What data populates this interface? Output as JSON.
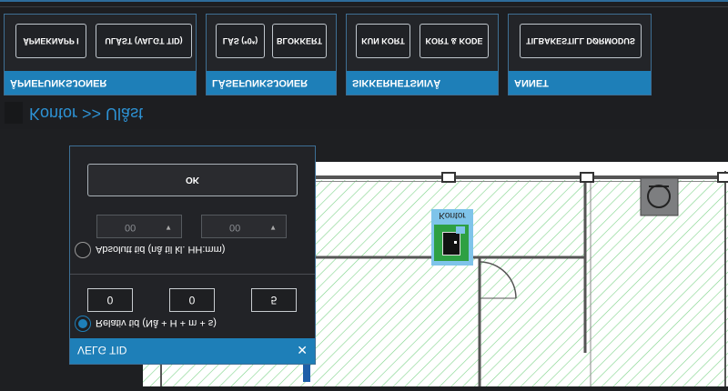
{
  "toolbar": {
    "groups": [
      {
        "caption": "ÅPNEFUNKSJONER",
        "buttons": [
          "ÅPNEKNAPP I",
          "ULÅST (VALGT TID)"
        ]
      },
      {
        "caption": "LÅSEFUNKSJONER",
        "buttons": [
          "LÅS (*0*)",
          "BLOKKERT"
        ]
      },
      {
        "caption": "SIKKERHETSNIVÅ",
        "buttons": [
          "KUN KORT",
          "KORT & KODE"
        ]
      },
      {
        "caption": "ANNET",
        "buttons": [
          "TILBAKESTILL DØRMODUS"
        ]
      }
    ]
  },
  "breadcrumb": "Kontor >> Ulåst",
  "floorplan": {
    "room_label": "Kontor"
  },
  "modal": {
    "title": "VELG TID",
    "ok_label": "OK",
    "absolute_label": "Absolutt tid (nå til kl. HH:mm)",
    "absolute_hours": "00",
    "absolute_minutes": "00",
    "relative_label": "Relativ tid (Nå + H + m + s)",
    "relative_h": "0",
    "relative_m": "0",
    "relative_s": "5",
    "close_symbol": "✕"
  },
  "colors": {
    "accent": "#1e7fb8",
    "room_green": "#2ea043",
    "hatch": "#6fcf7a"
  }
}
